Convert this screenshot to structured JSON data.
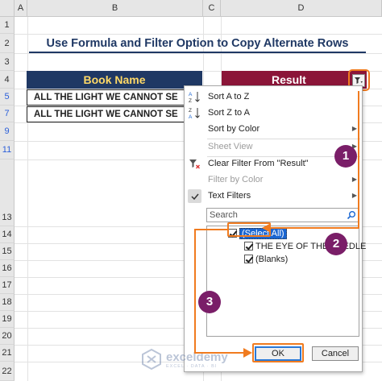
{
  "grid": {
    "columns": [
      "A",
      "B",
      "C",
      "D"
    ],
    "rows": [
      "1",
      "2",
      "3",
      "4",
      "5",
      "7",
      "9",
      "11",
      "13",
      "14",
      "15",
      "16",
      "17",
      "18",
      "19",
      "20",
      "21",
      "22"
    ]
  },
  "sheet": {
    "title": "Use Formula and Filter Option to Copy Alternate Rows",
    "header_book": "Book Name",
    "header_result": "Result",
    "cells": [
      "ALL THE LIGHT WE CANNOT SE",
      "ALL THE LIGHT WE CANNOT SE"
    ]
  },
  "menu": {
    "sort_az": "Sort A to Z",
    "sort_za": "Sort Z to A",
    "sort_color": "Sort by Color",
    "sheet_view": "Sheet View",
    "clear_filter": "Clear Filter From \"Result\"",
    "filter_color": "Filter by Color",
    "text_filters": "Text Filters",
    "search_placeholder": "Search",
    "items": [
      "(Select All)",
      "THE EYE OF THE NEEDLE",
      "(Blanks)"
    ],
    "ok": "OK",
    "cancel": "Cancel"
  },
  "annotations": [
    "1",
    "2",
    "3"
  ],
  "watermark": {
    "name": "exceldemy",
    "tagline": "EXCEL · DATA · BI"
  },
  "colors": {
    "book_header_bg": "#1f3864",
    "book_header_text": "#ffd966",
    "result_header_bg": "#8b1538",
    "annotation_orange": "#f07b1f",
    "badge_purple": "#7a1e68",
    "selection_blue": "#1a66d2"
  },
  "icons": [
    "sort-ascending-icon",
    "sort-descending-icon",
    "clear-filter-icon",
    "checkmark-icon",
    "search-icon",
    "filter-dropdown-icon",
    "submenu-arrow-icon"
  ]
}
